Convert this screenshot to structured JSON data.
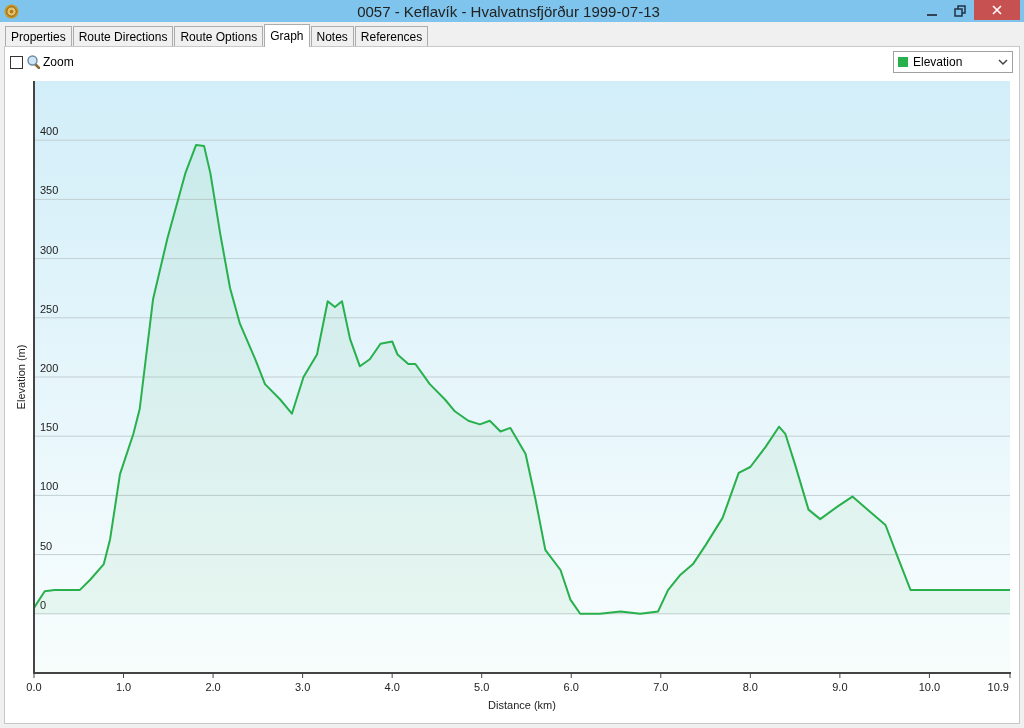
{
  "window": {
    "title": "0057 - Keflavík - Hvalvatnsfjörður 1999-07-13"
  },
  "tabs": [
    {
      "label": "Properties",
      "selected": false
    },
    {
      "label": "Route Directions",
      "selected": false
    },
    {
      "label": "Route Options",
      "selected": false
    },
    {
      "label": "Graph",
      "selected": true
    },
    {
      "label": "Notes",
      "selected": false
    },
    {
      "label": "References",
      "selected": false
    }
  ],
  "toolbar": {
    "zoom": {
      "label": "Zoom",
      "checked": false
    }
  },
  "graph": {
    "chart_data": {
      "type": "area",
      "xlabel": "Distance (km)",
      "ylabel": "Elevation (m)",
      "x": [
        0,
        0.12,
        0.23,
        0.51,
        0.63,
        0.78,
        0.85,
        0.96,
        1.11,
        1.18,
        1.33,
        1.49,
        1.69,
        1.81,
        1.9,
        1.97,
        2.08,
        2.19,
        2.3,
        2.47,
        2.58,
        2.75,
        2.88,
        3.01,
        3.16,
        3.28,
        3.36,
        3.44,
        3.53,
        3.64,
        3.75,
        3.87,
        4.0,
        4.06,
        4.18,
        4.26,
        4.42,
        4.59,
        4.7,
        4.85,
        4.98,
        5.09,
        5.21,
        5.32,
        5.49,
        5.6,
        5.71,
        5.88,
        5.99,
        6.1,
        6.32,
        6.55,
        6.77,
        6.97,
        7.08,
        7.22,
        7.36,
        7.5,
        7.69,
        7.87,
        8.0,
        8.17,
        8.32,
        8.39,
        8.5,
        8.65,
        8.78,
        8.98,
        9.14,
        9.34,
        9.51,
        9.65,
        9.79,
        10.9
      ],
      "series": [
        {
          "name": "Elevation",
          "color": "#27b04c",
          "values": [
            5,
            19,
            20,
            20,
            29,
            42,
            63,
            118,
            152,
            173,
            266,
            317,
            372,
            396,
            395,
            372,
            321,
            275,
            245,
            215,
            194,
            181,
            169,
            200,
            219,
            264,
            259,
            264,
            232,
            209,
            215,
            228,
            230,
            219,
            211,
            211,
            194,
            181,
            171,
            163,
            160,
            163,
            154,
            157,
            135,
            97,
            54,
            37,
            12,
            0,
            0,
            2,
            0,
            2,
            20,
            33,
            42,
            58,
            81,
            119,
            124,
            141,
            158,
            152,
            126,
            88,
            80,
            91,
            99,
            86,
            75,
            47,
            20,
            20
          ]
        }
      ],
      "grid": true,
      "xlim": [
        0,
        10.9
      ],
      "ylim": [
        -50,
        450
      ],
      "xticks": [
        {
          "value": 0,
          "label": "0.0"
        },
        {
          "value": 1,
          "label": "1.0"
        },
        {
          "value": 2,
          "label": "2.0"
        },
        {
          "value": 3,
          "label": "3.0"
        },
        {
          "value": 4,
          "label": "4.0"
        },
        {
          "value": 5,
          "label": "5.0"
        },
        {
          "value": 6,
          "label": "6.0"
        },
        {
          "value": 7,
          "label": "7.0"
        },
        {
          "value": 8,
          "label": "8.0"
        },
        {
          "value": 9,
          "label": "9.0"
        },
        {
          "value": 10,
          "label": "10.0"
        },
        {
          "value": 10.9,
          "label": "10.9"
        }
      ],
      "yticks": [
        0,
        50,
        100,
        150,
        200,
        250,
        300,
        350,
        400
      ]
    }
  }
}
